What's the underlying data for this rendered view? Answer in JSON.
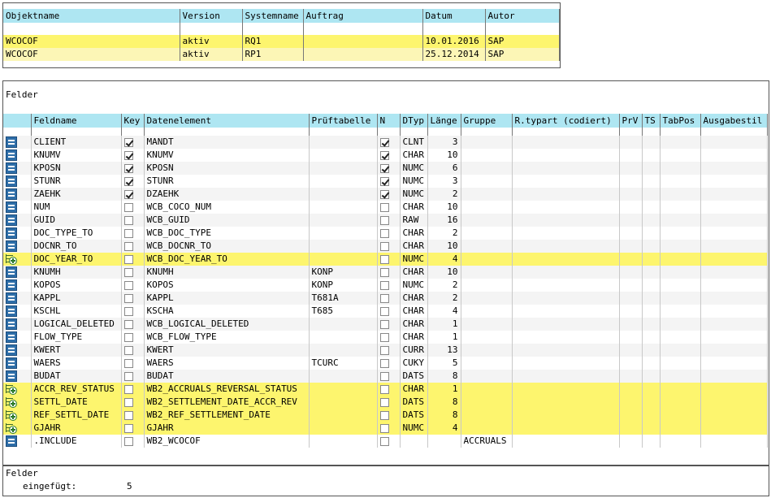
{
  "object_header": {
    "columns": [
      "Objektname",
      "Version",
      "Systemname",
      "Auftrag",
      "Datum",
      "Autor"
    ],
    "rows": [
      [
        "WCOCOF",
        "aktiv",
        "RQ1",
        "",
        "10.01.2016",
        "SAP"
      ],
      [
        "WCOCOF",
        "aktiv",
        "RP1",
        "",
        "25.12.2014",
        "SAP"
      ]
    ]
  },
  "fields_section": {
    "title": "Felder",
    "columns": [
      "",
      "Feldname",
      "Key",
      "Datenelement",
      "Prüftabelle",
      "N",
      "DTyp",
      "Länge",
      "Gruppe",
      "R.typart (codiert)",
      "PrV",
      "TS",
      "TabPos",
      "Ausgabestil"
    ],
    "rows": [
      {
        "icon": "equal-icon",
        "feldname": "CLIENT",
        "key": true,
        "datenelement": "MANDT",
        "prueftabelle": "",
        "n": true,
        "dtyp": "CLNT",
        "laenge": "3",
        "gruppe": "",
        "highlight": false
      },
      {
        "icon": "equal-icon",
        "feldname": "KNUMV",
        "key": true,
        "datenelement": "KNUMV",
        "prueftabelle": "",
        "n": true,
        "dtyp": "CHAR",
        "laenge": "10",
        "gruppe": "",
        "highlight": false
      },
      {
        "icon": "equal-icon",
        "feldname": "KPOSN",
        "key": true,
        "datenelement": "KPOSN",
        "prueftabelle": "",
        "n": true,
        "dtyp": "NUMC",
        "laenge": "6",
        "gruppe": "",
        "highlight": false
      },
      {
        "icon": "equal-icon",
        "feldname": "STUNR",
        "key": true,
        "datenelement": "STUNR",
        "prueftabelle": "",
        "n": true,
        "dtyp": "NUMC",
        "laenge": "3",
        "gruppe": "",
        "highlight": false
      },
      {
        "icon": "equal-icon",
        "feldname": "ZAEHK",
        "key": true,
        "datenelement": "DZAEHK",
        "prueftabelle": "",
        "n": true,
        "dtyp": "NUMC",
        "laenge": "2",
        "gruppe": "",
        "highlight": false
      },
      {
        "icon": "equal-icon",
        "feldname": "NUM",
        "key": false,
        "datenelement": "WCB_COCO_NUM",
        "prueftabelle": "",
        "n": false,
        "dtyp": "CHAR",
        "laenge": "10",
        "gruppe": "",
        "highlight": false
      },
      {
        "icon": "equal-icon",
        "feldname": "GUID",
        "key": false,
        "datenelement": "WCB_GUID",
        "prueftabelle": "",
        "n": false,
        "dtyp": "RAW",
        "laenge": "16",
        "gruppe": "",
        "highlight": false
      },
      {
        "icon": "equal-icon",
        "feldname": "DOC_TYPE_TO",
        "key": false,
        "datenelement": "WCB_DOC_TYPE",
        "prueftabelle": "",
        "n": false,
        "dtyp": "CHAR",
        "laenge": "2",
        "gruppe": "",
        "highlight": false
      },
      {
        "icon": "equal-icon",
        "feldname": "DOCNR_TO",
        "key": false,
        "datenelement": "WCB_DOCNR_TO",
        "prueftabelle": "",
        "n": false,
        "dtyp": "CHAR",
        "laenge": "10",
        "gruppe": "",
        "highlight": false
      },
      {
        "icon": "add-icon",
        "feldname": "DOC_YEAR_TO",
        "key": false,
        "datenelement": "WCB_DOC_YEAR_TO",
        "prueftabelle": "",
        "n": false,
        "dtyp": "NUMC",
        "laenge": "4",
        "gruppe": "",
        "highlight": true
      },
      {
        "icon": "equal-icon",
        "feldname": "KNUMH",
        "key": false,
        "datenelement": "KNUMH",
        "prueftabelle": "KONP",
        "n": false,
        "dtyp": "CHAR",
        "laenge": "10",
        "gruppe": "",
        "highlight": false
      },
      {
        "icon": "equal-icon",
        "feldname": "KOPOS",
        "key": false,
        "datenelement": "KOPOS",
        "prueftabelle": "KONP",
        "n": false,
        "dtyp": "NUMC",
        "laenge": "2",
        "gruppe": "",
        "highlight": false
      },
      {
        "icon": "equal-icon",
        "feldname": "KAPPL",
        "key": false,
        "datenelement": "KAPPL",
        "prueftabelle": "T681A",
        "n": false,
        "dtyp": "CHAR",
        "laenge": "2",
        "gruppe": "",
        "highlight": false
      },
      {
        "icon": "equal-icon",
        "feldname": "KSCHL",
        "key": false,
        "datenelement": "KSCHA",
        "prueftabelle": "T685",
        "n": false,
        "dtyp": "CHAR",
        "laenge": "4",
        "gruppe": "",
        "highlight": false
      },
      {
        "icon": "equal-icon",
        "feldname": "LOGICAL_DELETED",
        "key": false,
        "datenelement": "WCB_LOGICAL_DELETED",
        "prueftabelle": "",
        "n": false,
        "dtyp": "CHAR",
        "laenge": "1",
        "gruppe": "",
        "highlight": false
      },
      {
        "icon": "equal-icon",
        "feldname": "FLOW_TYPE",
        "key": false,
        "datenelement": "WCB_FLOW_TYPE",
        "prueftabelle": "",
        "n": false,
        "dtyp": "CHAR",
        "laenge": "1",
        "gruppe": "",
        "highlight": false
      },
      {
        "icon": "equal-icon",
        "feldname": "KWERT",
        "key": false,
        "datenelement": "KWERT",
        "prueftabelle": "",
        "n": false,
        "dtyp": "CURR",
        "laenge": "13",
        "gruppe": "",
        "highlight": false
      },
      {
        "icon": "equal-icon",
        "feldname": "WAERS",
        "key": false,
        "datenelement": "WAERS",
        "prueftabelle": "TCURC",
        "n": false,
        "dtyp": "CUKY",
        "laenge": "5",
        "gruppe": "",
        "highlight": false
      },
      {
        "icon": "equal-icon",
        "feldname": "BUDAT",
        "key": false,
        "datenelement": "BUDAT",
        "prueftabelle": "",
        "n": false,
        "dtyp": "DATS",
        "laenge": "8",
        "gruppe": "",
        "highlight": false
      },
      {
        "icon": "add-icon",
        "feldname": "ACCR_REV_STATUS",
        "key": false,
        "datenelement": "WB2_ACCRUALS_REVERSAL_STATUS",
        "prueftabelle": "",
        "n": false,
        "dtyp": "CHAR",
        "laenge": "1",
        "gruppe": "",
        "highlight": true
      },
      {
        "icon": "add-icon",
        "feldname": "SETTL_DATE",
        "key": false,
        "datenelement": "WB2_SETTLEMENT_DATE_ACCR_REV",
        "prueftabelle": "",
        "n": false,
        "dtyp": "DATS",
        "laenge": "8",
        "gruppe": "",
        "highlight": true
      },
      {
        "icon": "add-icon",
        "feldname": "REF_SETTL_DATE",
        "key": false,
        "datenelement": "WB2_REF_SETTLEMENT_DATE",
        "prueftabelle": "",
        "n": false,
        "dtyp": "DATS",
        "laenge": "8",
        "gruppe": "",
        "highlight": true
      },
      {
        "icon": "add-icon",
        "feldname": "GJAHR",
        "key": false,
        "datenelement": "GJAHR",
        "prueftabelle": "",
        "n": false,
        "dtyp": "NUMC",
        "laenge": "4",
        "gruppe": "",
        "highlight": true
      },
      {
        "icon": "equal-icon",
        "feldname": ".INCLUDE",
        "key": false,
        "datenelement": "WB2_WCOCOF",
        "prueftabelle": "",
        "n": false,
        "dtyp": "",
        "laenge": "",
        "gruppe": "ACCRUALS",
        "highlight": false
      }
    ]
  },
  "summary": {
    "title": "Felder",
    "label": "eingefügt:",
    "value": "5"
  }
}
